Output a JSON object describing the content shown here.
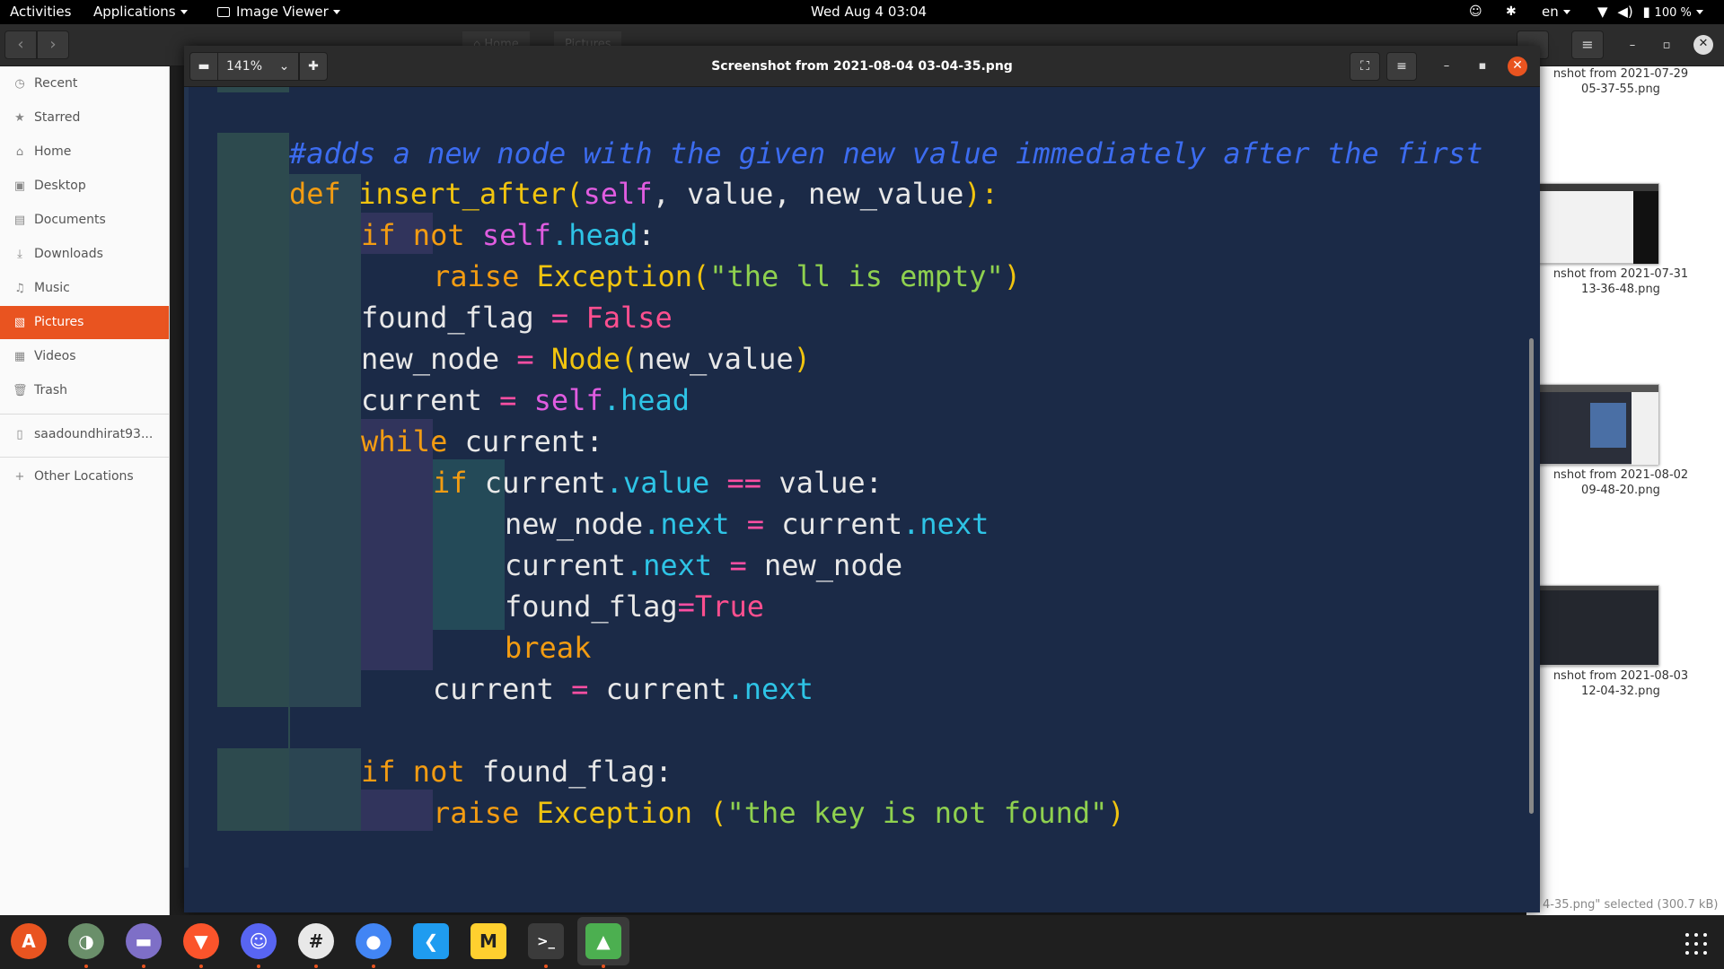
{
  "topbar": {
    "activities": "Activities",
    "applications": "Applications",
    "app_name": "Image Viewer",
    "clock": "Wed Aug 4  03:04",
    "lang": "en",
    "battery": "100 %"
  },
  "files": {
    "path_home": "Home",
    "path_pictures": "Pictures",
    "sidebar": [
      {
        "label": "Recent",
        "icon": "clock-icon"
      },
      {
        "label": "Starred",
        "icon": "star-icon"
      },
      {
        "label": "Home",
        "icon": "home-icon"
      },
      {
        "label": "Desktop",
        "icon": "desktop-icon"
      },
      {
        "label": "Documents",
        "icon": "document-icon"
      },
      {
        "label": "Downloads",
        "icon": "download-icon"
      },
      {
        "label": "Music",
        "icon": "music-icon"
      },
      {
        "label": "Pictures",
        "icon": "pictures-icon"
      },
      {
        "label": "Videos",
        "icon": "videos-icon"
      },
      {
        "label": "Trash",
        "icon": "trash-icon"
      },
      {
        "label": "saadoundhirat93...",
        "icon": "network-drive-icon"
      },
      {
        "label": "Other Locations",
        "icon": "plus-icon"
      }
    ],
    "thumbnails": [
      {
        "line1": "nshot from 2021-07-29",
        "line2": "05-37-55.png"
      },
      {
        "line1": "nshot from 2021-07-31",
        "line2": "13-36-48.png"
      },
      {
        "line1": "nshot from 2021-08-02",
        "line2": "09-48-20.png"
      },
      {
        "line1": "nshot from 2021-08-03",
        "line2": "12-04-32.png"
      }
    ],
    "status": "4-35.png\" selected  (300.7 kB)"
  },
  "viewer": {
    "zoom": "141%",
    "title": "Screenshot from 2021-08-04 03-04-35.png",
    "code": {
      "comment": "#adds a new node with the given new value immediately after the first",
      "def_kw": "def",
      "def_name": "insert_after",
      "def_open": "(",
      "def_self": "self",
      "def_params": ", value, new_value",
      "def_close": "):",
      "if1_kw": "if not",
      "if1_self": "self",
      "if1_attr": ".head",
      "if1_colon": ":",
      "raise1_kw": "raise",
      "raise1_fn": "Exception",
      "raise1_open": "(",
      "raise1_str": "\"the ll is empty\"",
      "raise1_close": ")",
      "ff_var": "found_flag",
      "ff_eq": "=",
      "ff_val": "False",
      "nn_var": "new_node",
      "nn_eq": "=",
      "nn_fn": "Node",
      "nn_open": "(",
      "nn_arg": "new_value",
      "nn_close": ")",
      "cur_var": "current",
      "cur_eq": "=",
      "cur_self": "self",
      "cur_attr": ".head",
      "while_kw": "while",
      "while_rest": " current:",
      "if2_kw": "if",
      "if2_var": "current",
      "if2_attr": ".value",
      "if2_eq": "==",
      "if2_rest": "value:",
      "a1_var": "new_node",
      "a1_attr": ".next",
      "a1_eq": "=",
      "a1_rhs": "current",
      "a1_rhs_attr": ".next",
      "a2_var": "current",
      "a2_attr": ".next",
      "a2_eq": "=",
      "a2_rhs": "new_node",
      "a3_var": "found_flag",
      "a3_eq": "=",
      "a3_val": "True",
      "break_kw": "break",
      "a4_var": "current",
      "a4_eq": "=",
      "a4_rhs": "current",
      "a4_attr": ".next",
      "if3_kw": "if not",
      "if3_rest": " found_flag:",
      "raise2_kw": "raise",
      "raise2_fn": "Exception",
      "raise2_open": " (",
      "raise2_str": "\"the key is not found\"",
      "raise2_close": ")"
    }
  },
  "dock": {
    "apps": [
      {
        "name": "ubuntu-software-icon",
        "glyph": "A",
        "color": "#e95420",
        "running": false
      },
      {
        "name": "toggle-app-icon",
        "glyph": "◑",
        "color": "#6a8f6a",
        "running": true
      },
      {
        "name": "files-icon",
        "glyph": "▬",
        "color": "#7e6fc7",
        "running": true
      },
      {
        "name": "brave-icon",
        "glyph": "▼",
        "color": "#fb542b",
        "running": true
      },
      {
        "name": "discord-icon",
        "glyph": "☺",
        "color": "#5865f2",
        "running": true
      },
      {
        "name": "slack-icon",
        "glyph": "#",
        "color": "#e8e8e8",
        "running": true
      },
      {
        "name": "chrome-icon",
        "glyph": "●",
        "color": "#4285f4",
        "running": true
      },
      {
        "name": "vscode-icon",
        "glyph": "❮",
        "color": "#1f9cf0",
        "running": false
      },
      {
        "name": "miro-icon",
        "glyph": "M",
        "color": "#ffd02f",
        "running": false
      },
      {
        "name": "terminal-icon",
        "glyph": ">_",
        "color": "#3b3b3b",
        "running": true
      },
      {
        "name": "image-viewer-icon",
        "glyph": "▲",
        "color": "#4caf50",
        "running": true
      }
    ]
  }
}
